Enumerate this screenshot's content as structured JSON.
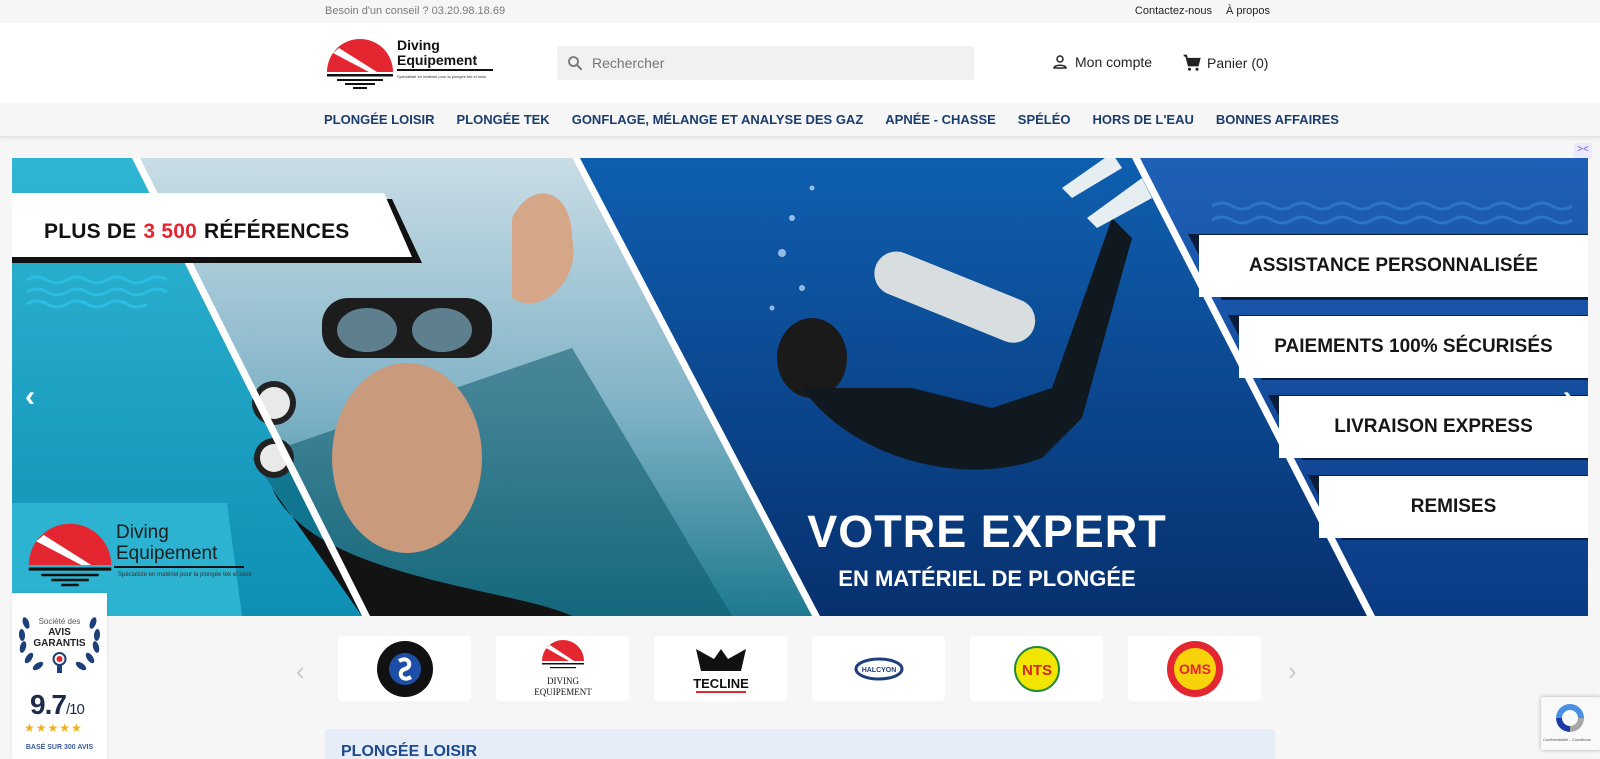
{
  "topbar": {
    "advice": "Besoin d'un conseil ? 03.20.98.18.69",
    "contact": "Contactez-nous",
    "about": "À propos"
  },
  "header": {
    "logo_line1": "Diving",
    "logo_line2": "Equipement",
    "logo_tagline": "Spécialiste en matériel pour la plongée tek et loisir",
    "search_placeholder": "Rechercher",
    "account": "Mon compte",
    "cart": "Panier (0)"
  },
  "nav": {
    "items": [
      "PLONGÉE LOISIR",
      "PLONGÉE TEK",
      "GONFLAGE, MÉLANGE ET ANALYSE DES GAZ",
      "APNÉE - CHASSE",
      "SPÉLÉO",
      "HORS DE L'EAU",
      "BONNES AFFAIRES"
    ]
  },
  "banner": {
    "references_prefix": "PLUS DE",
    "references_number": "3 500",
    "references_suffix": "RÉFÉRENCES",
    "features": [
      "ASSISTANCE PERSONNALISÉE",
      "PAIEMENTS 100% SÉCURISÉS",
      "LIVRAISON EXPRESS",
      "REMISES"
    ],
    "headline": "VOTRE EXPERT",
    "subheadline": "EN MATÉRIEL DE PLONGÉE",
    "logo_line1": "Diving",
    "logo_line2": "Equipement",
    "logo_tagline": "Spécialiste en matériel pour la plongée tek et loisir"
  },
  "brands": {
    "items": [
      "SCUBAPRO",
      "DIVING EQUIPEMENT",
      "TECLINE",
      "HALCYON",
      "NTS",
      "OMS"
    ],
    "diving_line1": "DIVING",
    "diving_line2": "EQUIPEMENT",
    "tecline": "TECLINE",
    "halcyon": "HALCYON",
    "nts": "NTS",
    "oms": "OMS"
  },
  "section": {
    "title": "PLONGÉE LOISIR"
  },
  "reviews": {
    "line1": "Société des",
    "line2": "AVIS",
    "line3": "GARANTIS",
    "score": "9.7",
    "scale": "/10",
    "stars": "★★★★★",
    "based": "BASÉ SUR 300 AVIS"
  },
  "recaptcha": {
    "text": "Confidentialité - Conditions"
  },
  "colors": {
    "nav_text": "#1a3c6e",
    "accent_red": "#e3262f",
    "banner_blue": "#0c3e8a",
    "banner_teal": "#1aa6c6"
  }
}
